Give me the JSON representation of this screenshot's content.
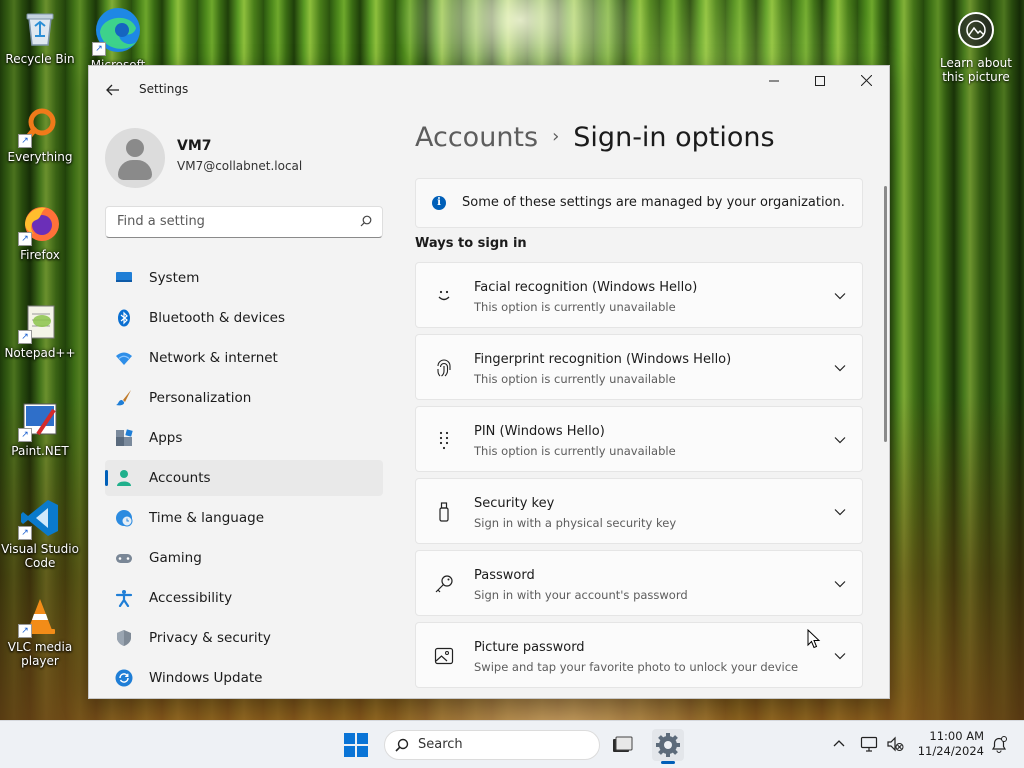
{
  "desktop": {
    "icons": [
      {
        "label": "Recycle Bin"
      },
      {
        "label": "Microsoft Edge"
      },
      {
        "label": "Everything"
      },
      {
        "label": "Firefox"
      },
      {
        "label": "Notepad++"
      },
      {
        "label": "Paint.NET"
      },
      {
        "label": "Visual Studio Code"
      },
      {
        "label": "VLC media player"
      }
    ],
    "learn_label": "Learn about this picture"
  },
  "window": {
    "title": "Settings",
    "controls": {
      "minimize": "—",
      "maximize": "☐",
      "close": "✕"
    },
    "profile": {
      "name": "VM7",
      "email": "VM7@collabnet.local"
    },
    "search": {
      "placeholder": "Find a setting"
    },
    "nav": [
      {
        "label": "System",
        "icon": "monitor-icon"
      },
      {
        "label": "Bluetooth & devices",
        "icon": "bluetooth-icon"
      },
      {
        "label": "Network & internet",
        "icon": "wifi-icon"
      },
      {
        "label": "Personalization",
        "icon": "brush-icon"
      },
      {
        "label": "Apps",
        "icon": "apps-icon"
      },
      {
        "label": "Accounts",
        "icon": "person-icon",
        "active": true
      },
      {
        "label": "Time & language",
        "icon": "globe-clock-icon"
      },
      {
        "label": "Gaming",
        "icon": "gamepad-icon"
      },
      {
        "label": "Accessibility",
        "icon": "accessibility-icon"
      },
      {
        "label": "Privacy & security",
        "icon": "shield-icon"
      },
      {
        "label": "Windows Update",
        "icon": "update-icon"
      }
    ],
    "breadcrumb": {
      "parent": "Accounts",
      "separator": "›",
      "current": "Sign-in options"
    },
    "info": "Some of these settings are managed by your organization.",
    "section_title": "Ways to sign in",
    "options": [
      {
        "title": "Facial recognition (Windows Hello)",
        "subtitle": "This option is currently unavailable",
        "icon": "face-icon"
      },
      {
        "title": "Fingerprint recognition (Windows Hello)",
        "subtitle": "This option is currently unavailable",
        "icon": "fingerprint-icon"
      },
      {
        "title": "PIN (Windows Hello)",
        "subtitle": "This option is currently unavailable",
        "icon": "pin-keypad-icon"
      },
      {
        "title": "Security key",
        "subtitle": "Sign in with a physical security key",
        "icon": "usb-key-icon"
      },
      {
        "title": "Password",
        "subtitle": "Sign in with your account's password",
        "icon": "key-icon"
      },
      {
        "title": "Picture password",
        "subtitle": "Swipe and tap your favorite photo to unlock your device",
        "icon": "picture-icon"
      }
    ]
  },
  "taskbar": {
    "search_label": "Search",
    "time": "11:00 AM",
    "date": "11/24/2024"
  },
  "colors": {
    "accent": "#005fb8",
    "window_bg": "#f3f3f3"
  }
}
